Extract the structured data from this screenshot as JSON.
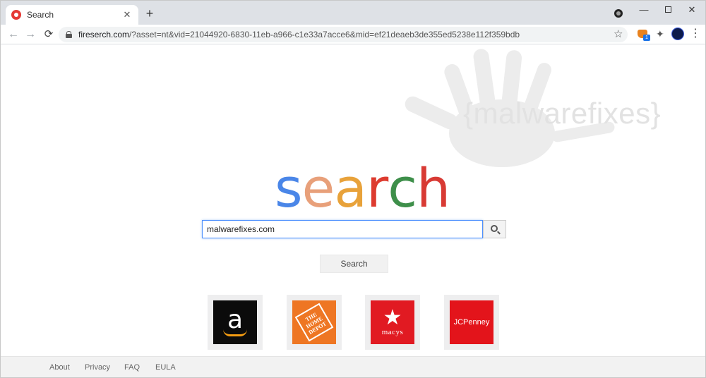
{
  "tab": {
    "title": "Search",
    "close": "✕",
    "new_tab": "+"
  },
  "window_controls": {
    "minimize": "—",
    "close": "✕"
  },
  "toolbar": {
    "back": "←",
    "forward": "→",
    "reload": "⟳",
    "url_host": "fireserch.com",
    "url_path": "/?asset=nt&vid=21044920-6830-11eb-a966-c1e33a7acce6&mid=ef21deaeb3de355ed5238e112f359bdb",
    "star": "☆",
    "ext_badge": "1",
    "puzzle": "✦",
    "menu": "⋮"
  },
  "watermark": "{malwarefixes}",
  "logo": {
    "letters": [
      "s",
      "e",
      "a",
      "r",
      "c",
      "h"
    ],
    "colors": [
      "#4a86e8",
      "#e8a07a",
      "#e8a23a",
      "#dd3b2f",
      "#3e8f4a",
      "#d83a34"
    ]
  },
  "search": {
    "value": "malwarefixes.com",
    "button_label": "Search"
  },
  "tiles": {
    "amazon": {
      "letter": "a"
    },
    "homedepot": {
      "text": "THE HOME DEPOT"
    },
    "macys": {
      "star": "★",
      "text": "macys"
    },
    "jcp": {
      "text": "JCPenney"
    }
  },
  "footer": {
    "about": "About",
    "privacy": "Privacy",
    "faq": "FAQ",
    "eula": "EULA"
  }
}
